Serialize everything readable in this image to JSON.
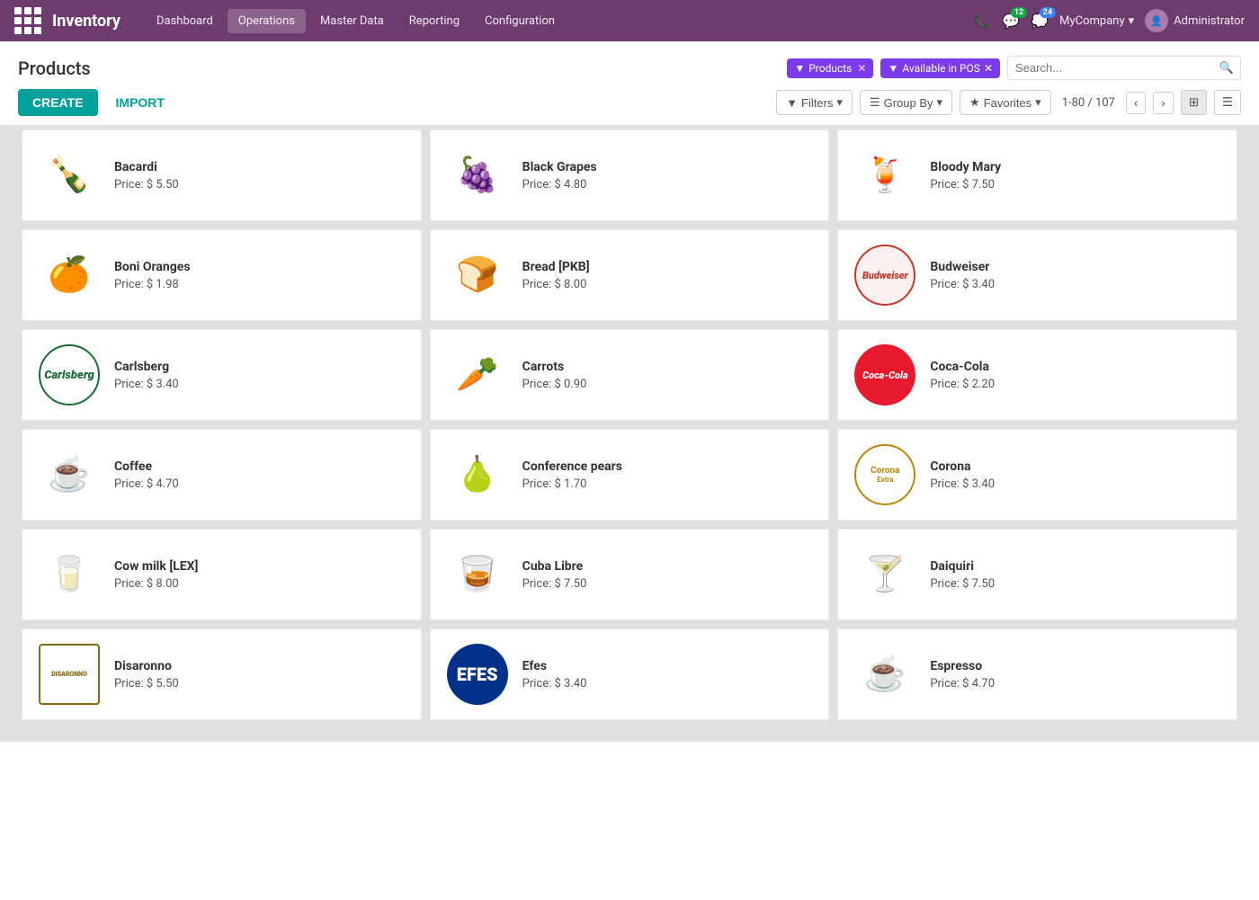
{
  "app": {
    "name": "Inventory",
    "nav": [
      {
        "label": "Dashboard",
        "active": false
      },
      {
        "label": "Operations",
        "active": true
      },
      {
        "label": "Master Data",
        "active": false
      },
      {
        "label": "Reporting",
        "active": false
      },
      {
        "label": "Configuration",
        "active": false
      }
    ],
    "badges": {
      "messages": "12",
      "activity": "24"
    },
    "company": "MyCompany",
    "user": "Administrator"
  },
  "page": {
    "title": "Products",
    "filters": [
      {
        "label": "Products",
        "removable": true
      },
      {
        "label": "Available in POS",
        "removable": true
      }
    ],
    "search_placeholder": "Search...",
    "buttons": {
      "create": "CREATE",
      "import": "IMPORT"
    },
    "toolbar": {
      "filters": "Filters",
      "group_by": "Group By",
      "favorites": "Favorites"
    },
    "pagination": {
      "current": "1-80",
      "total": "107"
    }
  },
  "products": [
    {
      "name": "Bacardi",
      "price": "Price: $ 5.50",
      "emoji": "🍾"
    },
    {
      "name": "Black Grapes",
      "price": "Price: $ 4.80",
      "emoji": "🍇"
    },
    {
      "name": "Bloody Mary",
      "price": "Price: $ 7.50",
      "emoji": "🍹"
    },
    {
      "name": "Boni Oranges",
      "price": "Price: $ 1.98",
      "emoji": "🍊"
    },
    {
      "name": "Bread [PKB]",
      "price": "Price: $ 8.00",
      "emoji": "🍞"
    },
    {
      "name": "Budweiser",
      "price": "Price: $ 3.40",
      "logo": "budweiser"
    },
    {
      "name": "Carlsberg",
      "price": "Price: $ 3.40",
      "logo": "carlsberg"
    },
    {
      "name": "Carrots",
      "price": "Price: $ 0.90",
      "emoji": "🥕"
    },
    {
      "name": "Coca-Cola",
      "price": "Price: $ 2.20",
      "logo": "coca"
    },
    {
      "name": "Coffee",
      "price": "Price: $ 4.70",
      "emoji": "☕"
    },
    {
      "name": "Conference pears",
      "price": "Price: $ 1.70",
      "emoji": "🍐"
    },
    {
      "name": "Corona",
      "price": "Price: $ 3.40",
      "logo": "corona"
    },
    {
      "name": "Cow milk [LEX]",
      "price": "Price: $ 8.00",
      "emoji": "🥛"
    },
    {
      "name": "Cuba Libre",
      "price": "Price: $ 7.50",
      "emoji": "🥃"
    },
    {
      "name": "Daiquiri",
      "price": "Price: $ 7.50",
      "emoji": "🍸"
    },
    {
      "name": "Disaronno",
      "price": "Price: $ 5.50",
      "logo": "disaronno"
    },
    {
      "name": "Efes",
      "price": "Price: $ 3.40",
      "logo": "efes"
    },
    {
      "name": "Espresso",
      "price": "Price: $ 4.70",
      "emoji": "☕"
    }
  ]
}
